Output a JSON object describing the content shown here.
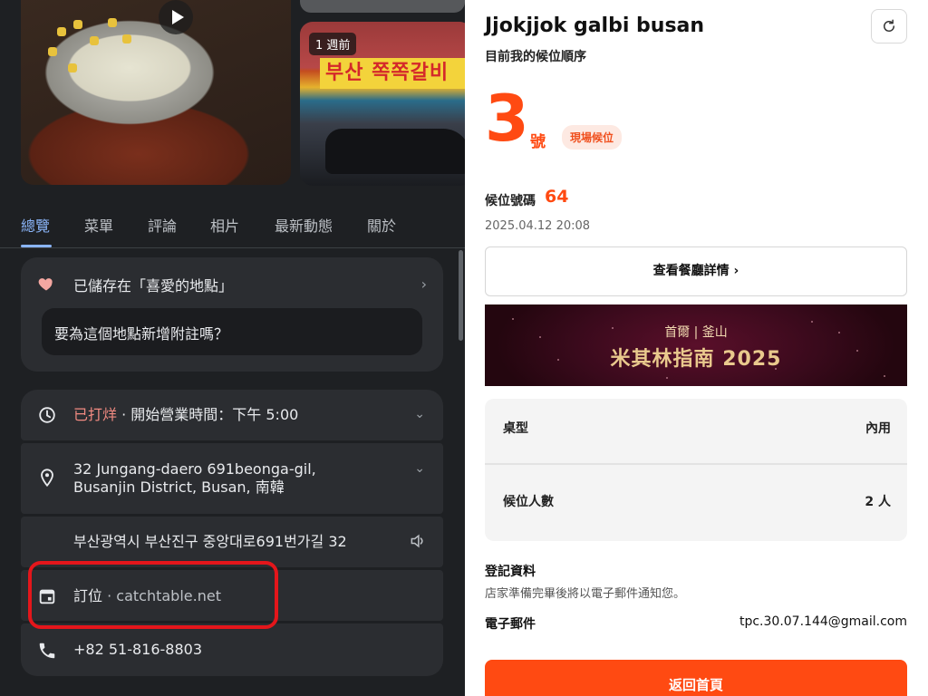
{
  "left_panel": {
    "photos": {
      "store_tag": "1 週前",
      "store_sign": "부산 쪽쪽갈비"
    },
    "tabs": [
      "總覽",
      "菜單",
      "評論",
      "相片",
      "最新動態",
      "關於"
    ],
    "active_tab": "總覽",
    "saved": {
      "text": "已儲存在「喜愛的地點」",
      "note_placeholder": "要為這個地點新增附註嗎？"
    },
    "hours": {
      "status": "已打烊",
      "separator": " · ",
      "detail": "開始營業時間：下午 5:00"
    },
    "address": {
      "line1": "32 Jungang-daero 691beonga-gil,",
      "line2": "Busanjin District, Busan, 南韓"
    },
    "korean_address": "부산광역시 부산진구 중앙대로691번가길 32",
    "booking": {
      "label": "訂位",
      "separator": " · ",
      "site": "catchtable.net"
    },
    "phone": "+82 51-816-8803"
  },
  "right_panel": {
    "title": "Jjokjjok galbi busan",
    "subtitle": "目前我的候位順序",
    "position_number": "3",
    "position_unit": "號",
    "badge": "現場候位",
    "queue_label": "候位號碼",
    "queue_number": "64",
    "datetime": "2025.04.12 20:08",
    "detail_button": "查看餐廳詳情 ›",
    "banner": {
      "top": "首爾 | 釜山",
      "main": "米其林指南 2025"
    },
    "info": [
      {
        "label": "桌型",
        "value": "內用"
      },
      {
        "label": "候位人數",
        "value": "2 人"
      }
    ],
    "registration": {
      "title": "登記資料",
      "desc": "店家準備完畢後將以電子郵件通知您。",
      "email_label": "電子郵件",
      "email_value": "tpc.30.07.144@gmail.com"
    },
    "home_button": "返回首頁"
  },
  "colors": {
    "accent_orange": "#ff4a12",
    "maps_blue": "#8ab4f8",
    "closed_red": "#f28b82",
    "highlight_red": "#e4161b"
  }
}
